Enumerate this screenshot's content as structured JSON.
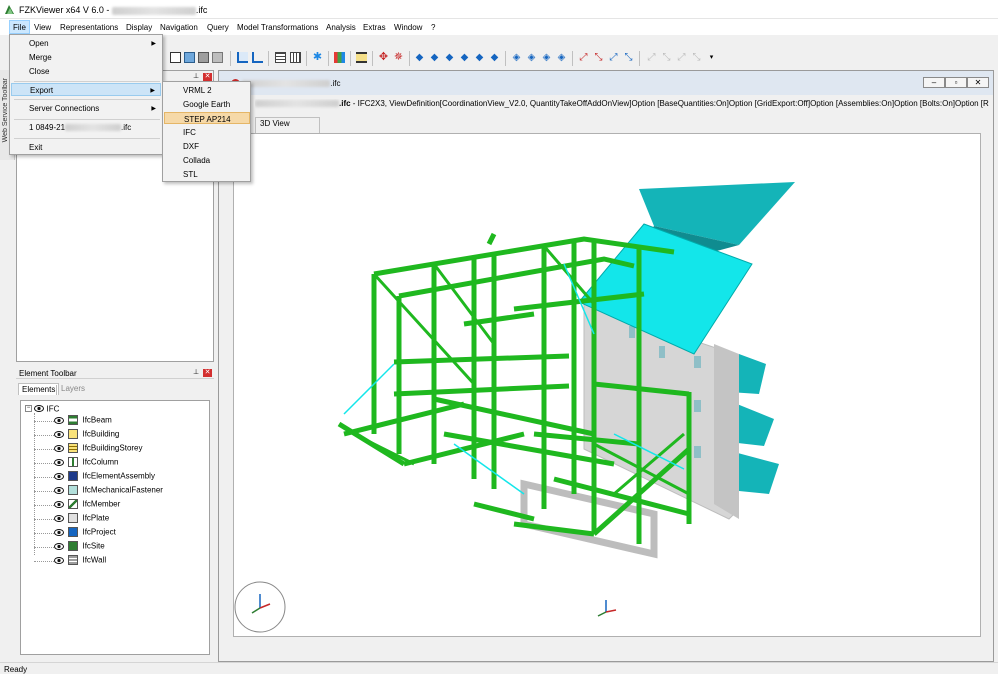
{
  "window": {
    "title_prefix": "FZKViewer x64 V 6.0 - ",
    "title_suffix": ".ifc"
  },
  "menubar": [
    "File",
    "View",
    "Representations",
    "Display",
    "Navigation",
    "Query",
    "Model Transformations",
    "Analysis",
    "Extras",
    "Window",
    "?"
  ],
  "file_menu": {
    "items": [
      "Open",
      "Merge",
      "Close",
      "Export",
      "Server Connections",
      "1 0849-21",
      "Exit"
    ],
    "recent_suffix": ".ifc"
  },
  "export_menu": {
    "items": [
      "VRML 2",
      "Google Earth",
      "STEP AP214",
      "IFC",
      "DXF",
      "Collada",
      "STL"
    ],
    "highlighted": "STEP AP214"
  },
  "left_strip_label": "Web Service Toolbar",
  "element_toolbar": {
    "title": "Element Toolbar",
    "tabs": [
      "Elements",
      "Layers"
    ],
    "root": "IFC",
    "entities": [
      "IfcBeam",
      "IfcBuilding",
      "IfcBuildingStorey",
      "IfcColumn",
      "IfcElementAssembly",
      "IfcMechanicalFastener",
      "IfcMember",
      "IfcPlate",
      "IfcProject",
      "IfcSite",
      "IfcWall"
    ]
  },
  "viewer": {
    "title_suffix": ".ifc",
    "info_suffix": ".ifc",
    "info": " - IFC2X3, ViewDefinition[CoordinationView_V2.0, QuantityTakeOffAddOnView]Option [BaseQuantities:On]Option [GridExport:Off]Option [Assemblies:On]Option [Bolts:On]Option [R",
    "tab": "3D View"
  },
  "status": "Ready",
  "colors": {
    "steel_green": "#1fb81f",
    "roof_cyan": "#13e6ea",
    "slab_teal": "#14b4b8",
    "wall_grey": "#d6d6d6",
    "menu_highlight": "#cce4f7",
    "export_highlight": "#f6d9a8"
  }
}
